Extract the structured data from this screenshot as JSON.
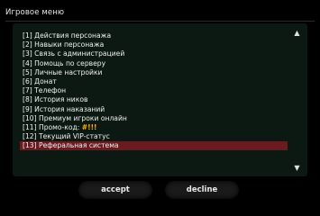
{
  "dialog": {
    "title": "Игровое меню",
    "items": [
      {
        "label": "[1] Действия персонажа"
      },
      {
        "label": "[2] Навыки персонажа"
      },
      {
        "label": "[3] Связь с администрацией"
      },
      {
        "label": "[4] Помощь по серверу"
      },
      {
        "label": "[5] Личные настройки"
      },
      {
        "label": "[6] Донат"
      },
      {
        "label": "[7] Телефон"
      },
      {
        "label": "[8] История ников"
      },
      {
        "label": "[9] История наказаний"
      },
      {
        "label": "[10] Премиум игроки онлайн"
      },
      {
        "label": "[11] Промо-код:",
        "badge": "#!!!"
      },
      {
        "label": "[12] Текущий VIP-статус"
      },
      {
        "label": "[13] Реферальная система"
      }
    ],
    "selected_index": 12,
    "scroll_up_icon": "▲",
    "scroll_down_icon": "▼",
    "accept_label": "accept",
    "decline_label": "decline",
    "colors": {
      "selection": "#6a1b1f",
      "panel": "#0b1912",
      "promo_icon": "#ffb000"
    }
  }
}
